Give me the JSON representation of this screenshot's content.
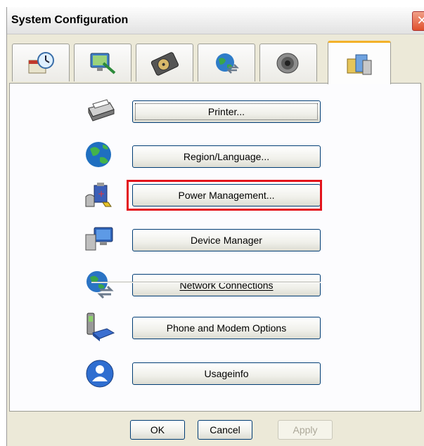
{
  "window": {
    "title": "System Configuration",
    "close_glyph": "✕"
  },
  "tabs": [
    {
      "name": "date-time",
      "icon": "clock-calendar-icon",
      "active": false
    },
    {
      "name": "display",
      "icon": "monitor-brush-icon",
      "active": false
    },
    {
      "name": "storage",
      "icon": "hard-disk-icon",
      "active": false
    },
    {
      "name": "network",
      "icon": "globe-network-icon",
      "active": false
    },
    {
      "name": "sound",
      "icon": "speaker-icon",
      "active": false
    },
    {
      "name": "system-tools",
      "icon": "tools-folder-icon",
      "active": true
    }
  ],
  "buttons": {
    "printer": "Printer...",
    "region": "Region/Language...",
    "power": "Power Management...",
    "device_manager": "Device Manager",
    "network_connections": "Network Connections",
    "phone_modem": "Phone and Modem Options",
    "usageinfo": "Usageinfo"
  },
  "footer": {
    "ok": "OK",
    "cancel": "Cancel",
    "apply": "Apply"
  },
  "colors": {
    "highlight": "#e3141c",
    "active_tab_accent": "#f3b12a"
  }
}
